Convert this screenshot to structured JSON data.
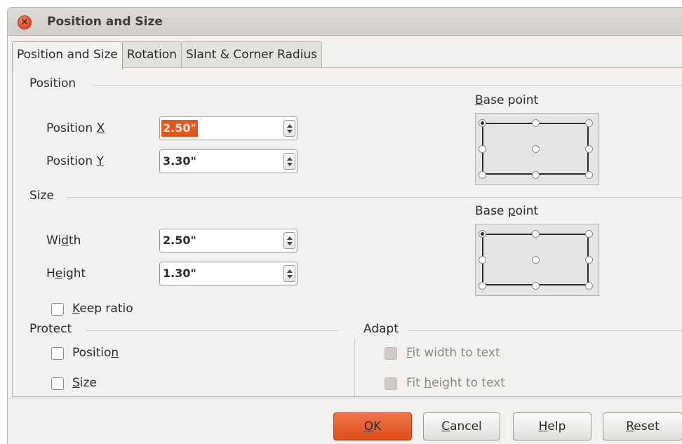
{
  "window": {
    "title": "Position and Size"
  },
  "tabs": [
    {
      "label": "Position and Size",
      "active": true
    },
    {
      "label": "Rotation",
      "active": false
    },
    {
      "label": "Slant & Corner Radius",
      "active": false
    }
  ],
  "position": {
    "heading": "Position",
    "x": {
      "label_pre": "Position ",
      "label_mn": "X",
      "label_post": "",
      "value": "2.50\""
    },
    "y": {
      "label_pre": "Position ",
      "label_mn": "Y",
      "label_post": "",
      "value": "3.30\""
    },
    "base_point": {
      "label_pre": "",
      "label_mn": "B",
      "label_post": "ase point",
      "selected": "top-left"
    }
  },
  "size": {
    "heading": "Size",
    "width": {
      "label_pre": "Wi",
      "label_mn": "d",
      "label_post": "th",
      "value": "2.50\""
    },
    "height": {
      "label_pre": "H",
      "label_mn": "e",
      "label_post": "ight",
      "value": "1.30\""
    },
    "base_point": {
      "label_pre": "Base ",
      "label_mn": "p",
      "label_post": "oint",
      "selected": "top-left"
    },
    "keep_ratio": {
      "label_pre": "",
      "label_mn": "K",
      "label_post": "eep ratio",
      "checked": false
    }
  },
  "protect": {
    "heading": "Protect",
    "position": {
      "label_pre": "Positio",
      "label_mn": "n",
      "label_post": "",
      "checked": false
    },
    "size": {
      "label_pre": "",
      "label_mn": "S",
      "label_post": "ize",
      "checked": false
    }
  },
  "adapt": {
    "heading": "Adapt",
    "fit_width": {
      "label_pre": "",
      "label_mn": "F",
      "label_post": "it width to text",
      "checked": false,
      "enabled": false
    },
    "fit_height": {
      "label_pre": "Fit ",
      "label_mn": "h",
      "label_post": "eight to text",
      "checked": false,
      "enabled": false
    }
  },
  "buttons": {
    "ok": {
      "label_pre": "",
      "label_mn": "O",
      "label_post": "K"
    },
    "cancel": {
      "label_pre": "",
      "label_mn": "C",
      "label_post": "ancel"
    },
    "help": {
      "label_pre": "",
      "label_mn": "H",
      "label_post": "elp"
    },
    "reset": {
      "label_pre": "",
      "label_mn": "R",
      "label_post": "eset"
    }
  },
  "colors": {
    "accent": "#df5220",
    "selection": "#e0581e",
    "dialog_bg": "#f2f1f0"
  }
}
